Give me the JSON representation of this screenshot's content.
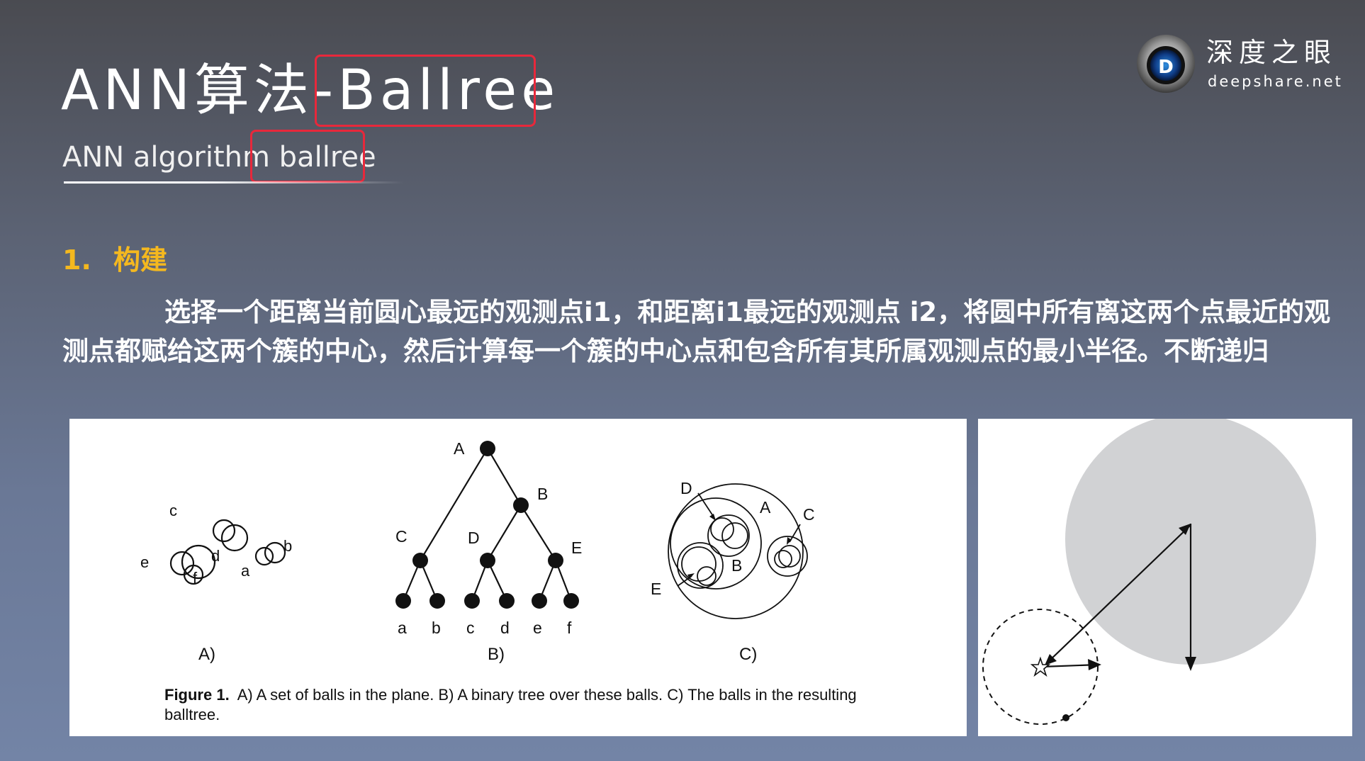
{
  "header": {
    "title": "ANN算法-Ballree",
    "subtitle": "ANN algorithm ballree"
  },
  "brand": {
    "name_cn": "深度之眼",
    "site": "deepshare.net",
    "logo_icon": "eye-d-logo"
  },
  "section": {
    "number": "1.",
    "heading": "构建"
  },
  "body": {
    "paragraph": "选择一个距离当前圆心最远的观测点i1，和距离i1最远的观测点 i2，将圆中所有离这两个点最近的观测点都赋给这两个簇的中心，然后计算每一个簇的中心点和包含所有其所属观测点的最小半径。不断递归"
  },
  "figure": {
    "panel_a": {
      "labels": [
        "c",
        "d",
        "e",
        "f",
        "a",
        "b"
      ],
      "caption": "A)"
    },
    "panel_b": {
      "nodes": [
        "A",
        "B",
        "C",
        "D",
        "E"
      ],
      "leaves": [
        "a",
        "b",
        "c",
        "d",
        "e",
        "f"
      ],
      "caption": "B)"
    },
    "panel_c": {
      "labels": [
        "D",
        "A",
        "C",
        "B",
        "E"
      ],
      "caption": "C)"
    },
    "caption_label": "Figure 1.",
    "caption_text": "A) A set of balls in the plane. B) A binary tree over these balls. C) The balls in the resulting balltree."
  },
  "colors": {
    "highlight": "#e8283b",
    "section": "#f4b81f",
    "ball_fill": "#d1d2d4"
  }
}
